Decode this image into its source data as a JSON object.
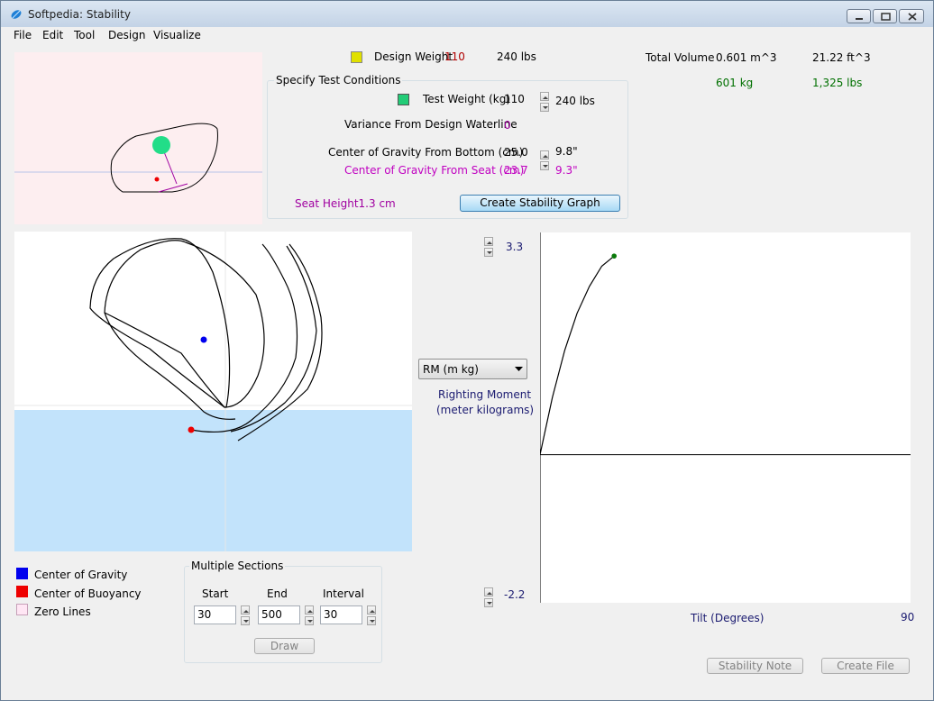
{
  "window": {
    "title": "Softpedia: Stability",
    "icon": "softpedia-leaf-icon"
  },
  "menu": {
    "items": [
      "File",
      "Edit",
      "Tool",
      "Design",
      "Visualize"
    ]
  },
  "design": {
    "weight_label": "Design Weight",
    "weight_value": "110",
    "weight_lbs": "240 lbs",
    "swatch_color": "#e0e000"
  },
  "volume": {
    "label": "Total Volume",
    "m3": "0.601 m^3",
    "ft3": "21.22 ft^3",
    "kg": "601 kg",
    "lbs": "1,325 lbs"
  },
  "test": {
    "group_label": "Specify Test Conditions",
    "weight_label": "Test Weight (kg)",
    "weight_value": "110",
    "weight_lbs": "240 lbs",
    "swatch_color": "#22cc77",
    "variance_label": "Variance From Design Waterline",
    "variance_value": "0",
    "cg_bottom_label": "Center of Gravity From Bottom (cm)",
    "cg_bottom_value": "25.0",
    "cg_bottom_in": "9.8\"",
    "cg_seat_label": "Center of Gravity From Seat (cm)",
    "cg_seat_value": "23.7",
    "cg_seat_in": "9.3\"",
    "seat_height": "Seat Height1.3 cm",
    "create_graph": "Create Stability Graph"
  },
  "graph": {
    "y_max": "3.3",
    "y_min": "-2.2",
    "dropdown": "RM (m kg)",
    "y_title_line1": "Righting Moment",
    "y_title_line2": "(meter kilograms)",
    "x_title": "Tilt (Degrees)",
    "x_max": "90"
  },
  "legend": {
    "items": [
      {
        "label": "Center of Gravity",
        "color": "#0000ee"
      },
      {
        "label": "Center of Buoyancy",
        "color": "#ee0000"
      },
      {
        "label": "Zero Lines",
        "color": "#ffe6f4"
      }
    ]
  },
  "sections": {
    "group_label": "Multiple Sections",
    "start_label": "Start",
    "end_label": "End",
    "interval_label": "Interval",
    "start_value": "30",
    "end_value": "500",
    "interval_value": "30",
    "draw": "Draw"
  },
  "buttons": {
    "stability_note": "Stability Note",
    "create_file": "Create File"
  },
  "chart_data": {
    "type": "line",
    "xlabel": "Tilt (Degrees)",
    "ylabel": "Righting Moment (meter kilograms)",
    "xlim": [
      0,
      90
    ],
    "ylim": [
      -2.2,
      3.3
    ],
    "series": [
      {
        "x": [
          0,
          3,
          6,
          9,
          12,
          15,
          18
        ],
        "y": [
          0,
          0.85,
          1.55,
          2.1,
          2.5,
          2.8,
          2.95
        ]
      }
    ]
  }
}
